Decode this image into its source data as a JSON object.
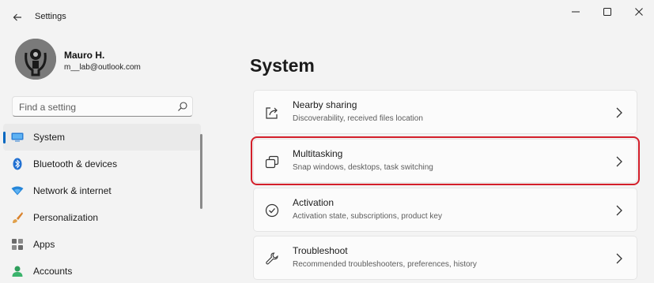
{
  "window": {
    "title": "Settings"
  },
  "profile": {
    "name": "Mauro H.",
    "email": "m__lab@outlook.com"
  },
  "search": {
    "placeholder": "Find a setting"
  },
  "sidebar": {
    "items": [
      {
        "label": "System",
        "icon": "system-display-icon",
        "selected": true
      },
      {
        "label": "Bluetooth & devices",
        "icon": "bluetooth-icon"
      },
      {
        "label": "Network & internet",
        "icon": "wifi-icon"
      },
      {
        "label": "Personalization",
        "icon": "brush-icon"
      },
      {
        "label": "Apps",
        "icon": "apps-grid-icon"
      },
      {
        "label": "Accounts",
        "icon": "person-icon"
      }
    ]
  },
  "main": {
    "title": "System",
    "cards": [
      {
        "title": "Nearby sharing",
        "subtitle": "Discoverability, received files location",
        "icon": "share-icon"
      },
      {
        "title": "Multitasking",
        "subtitle": "Snap windows, desktops, task switching",
        "icon": "multitasking-icon",
        "highlighted": true
      },
      {
        "title": "Activation",
        "subtitle": "Activation state, subscriptions, product key",
        "icon": "activation-check-icon"
      },
      {
        "title": "Troubleshoot",
        "subtitle": "Recommended troubleshooters, preferences, history",
        "icon": "wrench-icon"
      }
    ]
  },
  "colors": {
    "accent": "#0067c0",
    "highlight_border": "#d31f2a",
    "background": "#f3f3f3",
    "card": "#fbfbfb"
  }
}
